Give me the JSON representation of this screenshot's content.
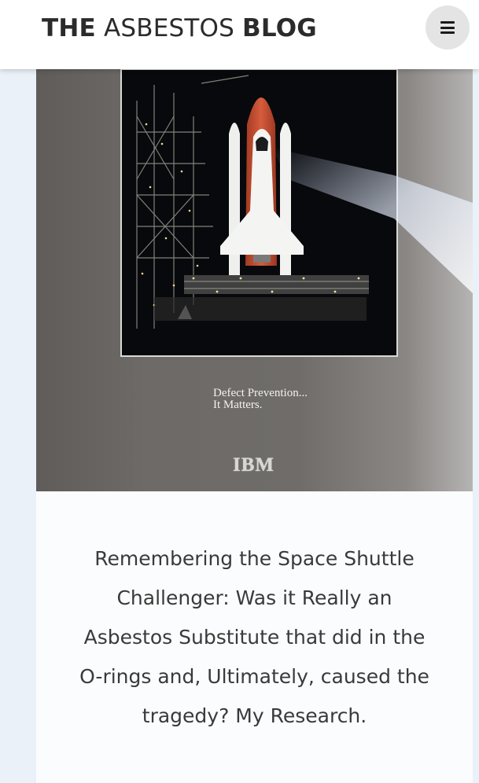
{
  "header": {
    "brand_part1": "THE",
    "brand_part2": "ASBESTOS",
    "brand_part3": "BLOG",
    "menu_icon": "hamburger-menu-icon"
  },
  "post": {
    "image": {
      "tagline_line1": "Defect Prevention...",
      "tagline_line2": "It Matters.",
      "logo_text": "IBM"
    },
    "title": "Remembering the Space Shuttle Challenger: Was it Really an Asbestos Substitute that did in the O-rings and, Ultimately, caused the tragedy? My Research."
  },
  "colors": {
    "background": "#eaf1f8",
    "header": "#ffffff",
    "text": "#3a3a3a",
    "menu_button": "#e4e4e4"
  }
}
